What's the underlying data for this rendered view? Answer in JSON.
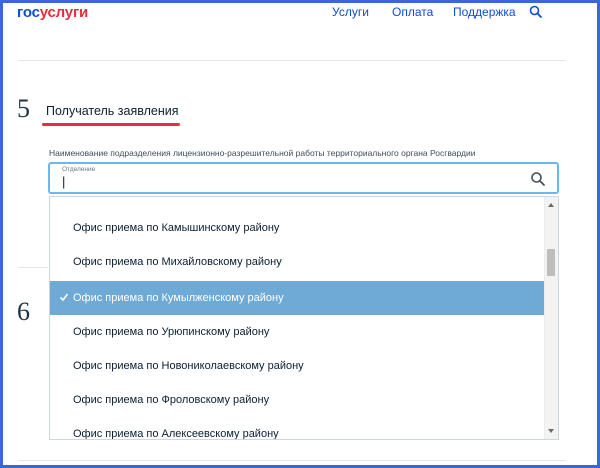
{
  "header": {
    "logo_part1": "гос",
    "logo_part2": "услуги",
    "nav": [
      {
        "label": "Услуги"
      },
      {
        "label": "Оплата"
      },
      {
        "label": "Поддержка"
      }
    ],
    "search_icon": "search-icon"
  },
  "section5": {
    "number": "5",
    "title": "Получатель заявления",
    "field_caption": "Наименование подразделения лицензионно-разрешительной работы территориального органа Росгвардии",
    "input": {
      "label": "Отделение",
      "value": "|",
      "icon": "search-icon"
    }
  },
  "section6": {
    "number": "6"
  },
  "dropdown": {
    "options": [
      {
        "label": "Офис приема по Камышинскому району",
        "selected": false
      },
      {
        "label": "Офис приема по Михайловскому району",
        "selected": false
      },
      {
        "label": "Офис приема по Кумылженскому району",
        "selected": true
      },
      {
        "label": "Офис приема по Урюпинскому району",
        "selected": false
      },
      {
        "label": "Офис приема по Новониколаевскому району",
        "selected": false
      },
      {
        "label": "Офис приема по Фроловскому району",
        "selected": false
      },
      {
        "label": "Офис приема по Алексеевскому району",
        "selected": false
      }
    ]
  },
  "colors": {
    "brand_blue": "#0d4cd3",
    "brand_red": "#e52f3c",
    "selected_bg": "#6fa9d5",
    "input_border": "#70b6e8",
    "frame": "#3a66d6"
  }
}
